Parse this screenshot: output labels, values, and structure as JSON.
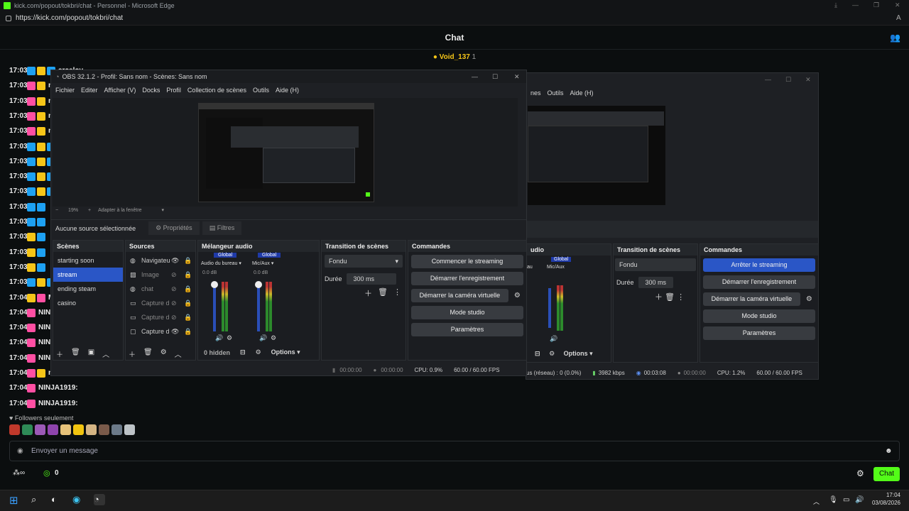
{
  "browser": {
    "title": "kick.com/popout/tokbri/chat - Personnel - Microsoft Edge",
    "url": "https://kick.com/popout/tokbri/chat"
  },
  "chat": {
    "header": "Chat",
    "pinned_user": "Void_137",
    "pinned_count": "1",
    "messages": [
      {
        "time": "17:03",
        "user": "arcelov",
        "badges": [
          "#1da1f2",
          "#f5c518",
          "#1da1f2"
        ]
      },
      {
        "time": "17:03",
        "user": "naje",
        "badges": [
          "#ff4fa3",
          "#f5c518"
        ]
      },
      {
        "time": "17:03",
        "user": "naje",
        "badges": [
          "#ff4fa3",
          "#f5c518"
        ]
      },
      {
        "time": "17:03",
        "user": "naje",
        "badges": [
          "#ff4fa3",
          "#f5c518"
        ]
      },
      {
        "time": "17:03",
        "user": "naje",
        "badges": [
          "#ff4fa3",
          "#f5c518"
        ]
      },
      {
        "time": "17:03",
        "user": "",
        "badges": [
          "#1da1f2",
          "#f5c518",
          "#1da1f2"
        ]
      },
      {
        "time": "17:03",
        "user": "",
        "badges": [
          "#1da1f2",
          "#f5c518",
          "#1da1f2"
        ]
      },
      {
        "time": "17:03",
        "user": "",
        "badges": [
          "#1da1f2",
          "#f5c518",
          "#1da1f2"
        ]
      },
      {
        "time": "17:03",
        "user": "",
        "badges": [
          "#1da1f2",
          "#f5c518",
          "#1da1f2"
        ]
      },
      {
        "time": "17:03",
        "user": "",
        "badges": [
          "#1da1f2",
          "#1da1f2"
        ]
      },
      {
        "time": "17:03",
        "user": "",
        "badges": [
          "#1da1f2",
          "#1da1f2"
        ]
      },
      {
        "time": "17:03",
        "user": "",
        "badges": [
          "#f5c518",
          "#1da1f2"
        ]
      },
      {
        "time": "17:03",
        "user": "",
        "badges": [
          "#f5c518",
          "#1da1f2"
        ]
      },
      {
        "time": "17:03",
        "user": "",
        "badges": [
          "#f5c518",
          "#1da1f2"
        ]
      },
      {
        "time": "17:03",
        "user": "Zg_",
        "badges": [
          "#1da1f2",
          "#f5c518",
          "#1da1f2"
        ]
      },
      {
        "time": "17:04",
        "user": "Mik",
        "badges": [
          "#f5c518",
          "#ff4fa3"
        ]
      },
      {
        "time": "17:04",
        "user": "NINJ",
        "badges": [
          "#ff4fa3"
        ]
      },
      {
        "time": "17:04",
        "user": "NINJ",
        "badges": [
          "#ff4fa3"
        ]
      },
      {
        "time": "17:04",
        "user": "NINJ",
        "badges": [
          "#ff4fa3"
        ]
      },
      {
        "time": "17:04",
        "user": "NINJ",
        "badges": [
          "#ff4fa3"
        ]
      },
      {
        "time": "17:04",
        "user": "naje",
        "badges": [
          "#ff4fa3",
          "#f5c518"
        ]
      },
      {
        "time": "17:04",
        "user": "NINJA1919:",
        "badges": [
          "#ff4fa3"
        ]
      },
      {
        "time": "17:04",
        "user": "NINJA1919:",
        "badges": [
          "#ff4fa3"
        ]
      }
    ],
    "followers_only": "Followers seulement",
    "input_placeholder": "Envoyer un message",
    "points": "0",
    "send_label": "Chat"
  },
  "obs_front": {
    "title": "OBS 32.1.2 - Profil: Sans nom - Scènes: Sans nom",
    "menu": [
      "Fichier",
      "Editer",
      "Afficher (V)",
      "Docks",
      "Profil",
      "Collection de scènes",
      "Outils",
      "Aide (H)"
    ],
    "zoom": "19%",
    "fit": "Adapter à la fenêtre",
    "no_source": "Aucune source sélectionnée",
    "properties": "Propriétés",
    "filters": "Filtres",
    "scenes_title": "Scènes",
    "scenes": [
      "starting soon",
      "stream",
      "ending steam",
      "casino"
    ],
    "sources_title": "Sources",
    "sources": [
      "Navigateu",
      "Image",
      "chat",
      "Capture d",
      "Capture d",
      "Capture d"
    ],
    "mixer_title": "Mélangeur audio",
    "mixer_ch1": "Audio du bureau",
    "mixer_ch2": "Mic/Aux",
    "global": "Global",
    "db": "0.0 dB",
    "hidden": "0 hidden",
    "options": "Options",
    "transition_title": "Transition de scènes",
    "transition": "Fondu",
    "duration_label": "Durée",
    "duration": "300 ms",
    "commands_title": "Commandes",
    "cmd_stream": "Commencer le streaming",
    "cmd_record": "Démarrer l'enregistrement",
    "cmd_vcam": "Démarrer la caméra virtuelle",
    "cmd_studio": "Mode studio",
    "cmd_settings": "Paramètres",
    "status_t1": "00:00:00",
    "status_t2": "00:00:00",
    "cpu": "CPU: 0.9%",
    "fps": "60.00 / 60.00 FPS"
  },
  "obs_back": {
    "menu": [
      "nes",
      "Outils",
      "Aide (H)"
    ],
    "mixer_title": "udio",
    "mixer_ch1": "au",
    "mixer_ch2": "Mic/Aux",
    "global": "Global",
    "options": "Options",
    "transition_title": "Transition de scènes",
    "transition": "Fondu",
    "duration_label": "Durée",
    "duration": "300 ms",
    "commands_title": "Commandes",
    "cmd_stream": "Arrêter le streaming",
    "cmd_record": "Démarrer l'enregistrement",
    "cmd_vcam": "Démarrer la caméra virtuelle",
    "cmd_studio": "Mode studio",
    "cmd_settings": "Paramètres",
    "net": "us (réseau) : 0 (0.0%)",
    "kbps": "3982 kbps",
    "live_time": "00:03:08",
    "rec_time": "00:00:00",
    "cpu": "CPU: 1.2%",
    "fps": "60.00 / 60.00 FPS"
  },
  "taskbar": {
    "time": "17:04",
    "date": "03/08/2026"
  }
}
